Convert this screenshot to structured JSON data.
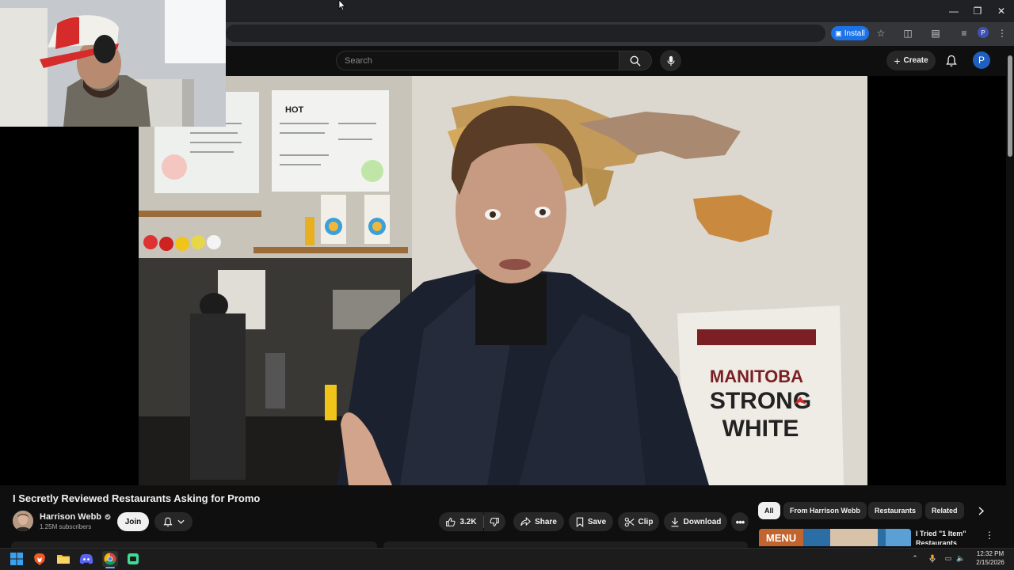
{
  "browser": {
    "install_label": "Install"
  },
  "youtube_header": {
    "search_placeholder": "Search",
    "create_label": "Create",
    "account_initial": "P"
  },
  "video": {
    "title": "I Secretly Reviewed Restaurants Asking for Promo",
    "scene_texts": {
      "menu_heading": "HOT",
      "bag_text_1": "MANITOBA",
      "bag_text_2": "STRONG",
      "bag_text_3": "WHITE"
    }
  },
  "channel": {
    "name": "Harrison Webb",
    "subscribers": "1.25M subscribers",
    "join_label": "Join"
  },
  "actions": {
    "likes": "3.2K",
    "share": "Share",
    "save": "Save",
    "clip": "Clip",
    "download": "Download"
  },
  "chips": [
    "All",
    "From Harrison Webb",
    "Restaurants",
    "Related"
  ],
  "recommendation": {
    "thumb_text": "MENU",
    "title_line1": "I Tried \"1 Item\"",
    "title_line2": "Restaurants"
  },
  "taskbar": {
    "time": "12:32 PM",
    "date": "2/15/2026"
  },
  "colors": {
    "background": "#0f0f0f",
    "accent_blue": "#1a73e8",
    "chip_active": "#f1f1f1"
  }
}
